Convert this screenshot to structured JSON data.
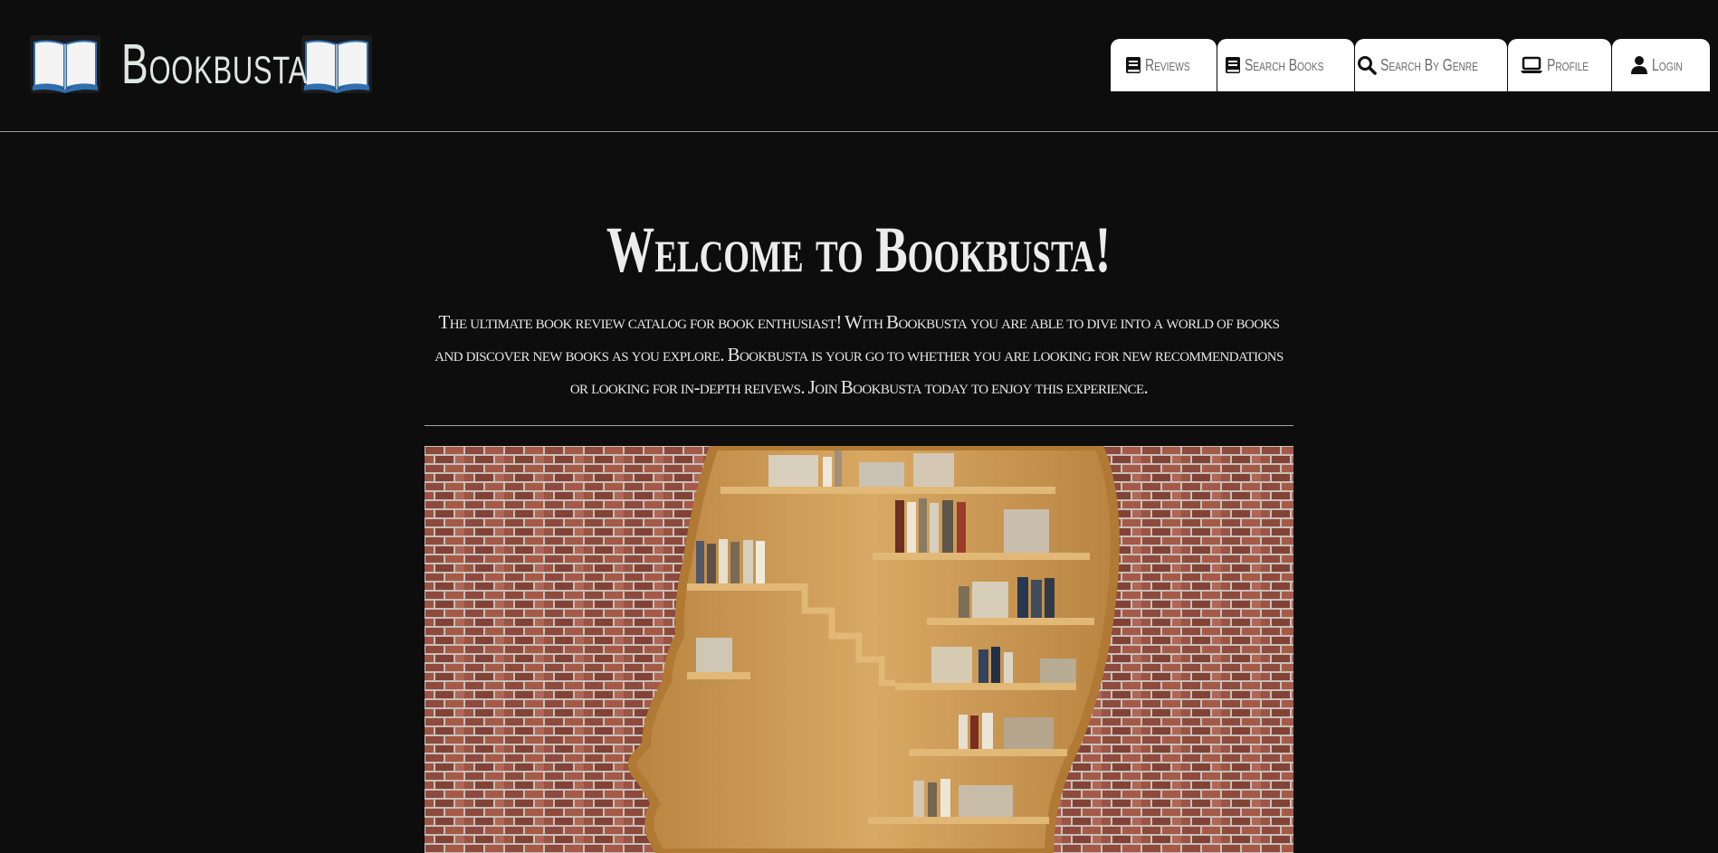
{
  "header": {
    "brand_name": "Bookbusta",
    "left_icon": "open-book-icon",
    "right_icon": "open-book-icon"
  },
  "nav": {
    "items": [
      {
        "label": "Reviews",
        "icon": "book-icon"
      },
      {
        "label": "Search Books",
        "icon": "book-icon"
      },
      {
        "label": "Search By Genre",
        "icon": "search-icon"
      },
      {
        "label": "Profile",
        "icon": "laptop-icon"
      },
      {
        "label": "Login",
        "icon": "user-icon"
      }
    ]
  },
  "main": {
    "title": "Welcome to Bookbusta!",
    "intro": "The ultimate book review catalog for book enthusiast! With Bookbusta you are able to dive into a world of books and discover new books as you explore. Bookbusta is your go to whether you are looking for new recommendations or looking for in-depth reivews. Join Bookbusta today to enjoy this experience."
  },
  "colors": {
    "background": "#0d0d0d",
    "text": "#e6e6e6",
    "nav_bg": "#ffffff",
    "nav_text": "#6b6b6b",
    "brick": "#8e4a3c",
    "wood": "#c8964e"
  }
}
